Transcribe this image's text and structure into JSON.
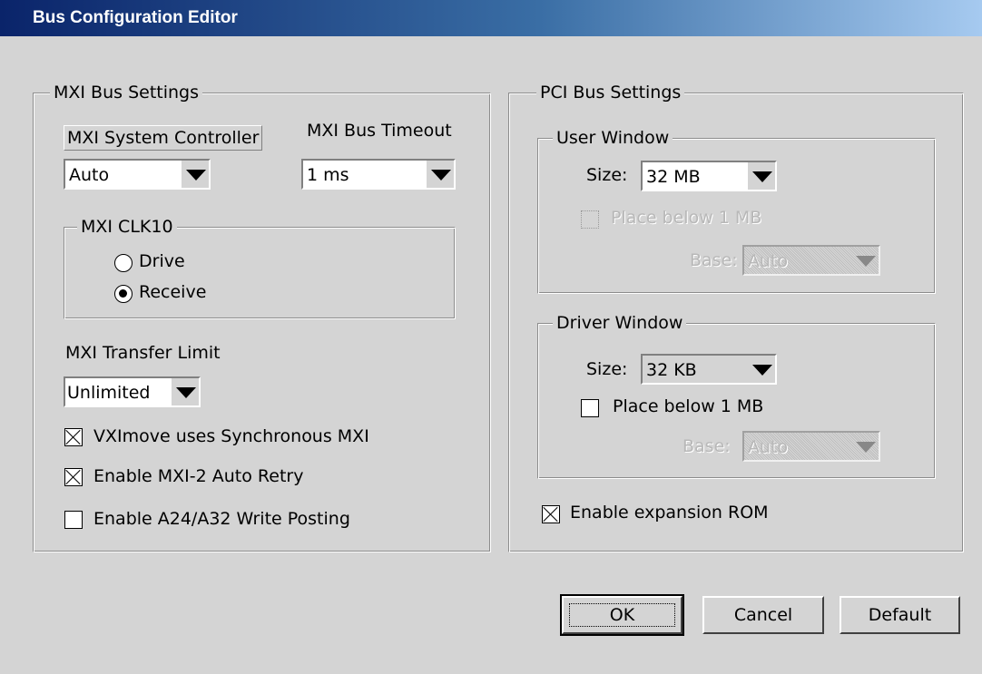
{
  "window": {
    "title": "Bus Configuration Editor"
  },
  "mxi": {
    "group_label": "MXI Bus Settings",
    "system_controller": {
      "label": "MXI System Controller",
      "value": "Auto"
    },
    "bus_timeout": {
      "label": "MXI Bus Timeout",
      "value": "1 ms"
    },
    "clk10": {
      "label": "MXI CLK10",
      "drive": "Drive",
      "receive": "Receive",
      "selected": "Receive"
    },
    "transfer_limit": {
      "label": "MXI Transfer Limit",
      "value": "Unlimited"
    },
    "vximove_sync": {
      "label": "VXImove uses Synchronous MXI",
      "checked": true
    },
    "auto_retry": {
      "label": "Enable MXI-2 Auto Retry",
      "checked": true
    },
    "write_posting": {
      "label": "Enable A24/A32 Write Posting",
      "checked": false
    }
  },
  "pci": {
    "group_label": "PCI Bus Settings",
    "user_window": {
      "label": "User Window",
      "size_label": "Size:",
      "size_value": "32 MB",
      "place_below": "Place below 1 MB",
      "place_below_checked": false,
      "base_label": "Base:",
      "base_value": "Auto"
    },
    "driver_window": {
      "label": "Driver Window",
      "size_label": "Size:",
      "size_value": "32 KB",
      "place_below": "Place below 1 MB",
      "place_below_checked": false,
      "base_label": "Base:",
      "base_value": "Auto"
    },
    "expansion_rom": {
      "label": "Enable expansion ROM",
      "checked": true
    }
  },
  "buttons": {
    "ok": "OK",
    "cancel": "Cancel",
    "default": "Default"
  }
}
